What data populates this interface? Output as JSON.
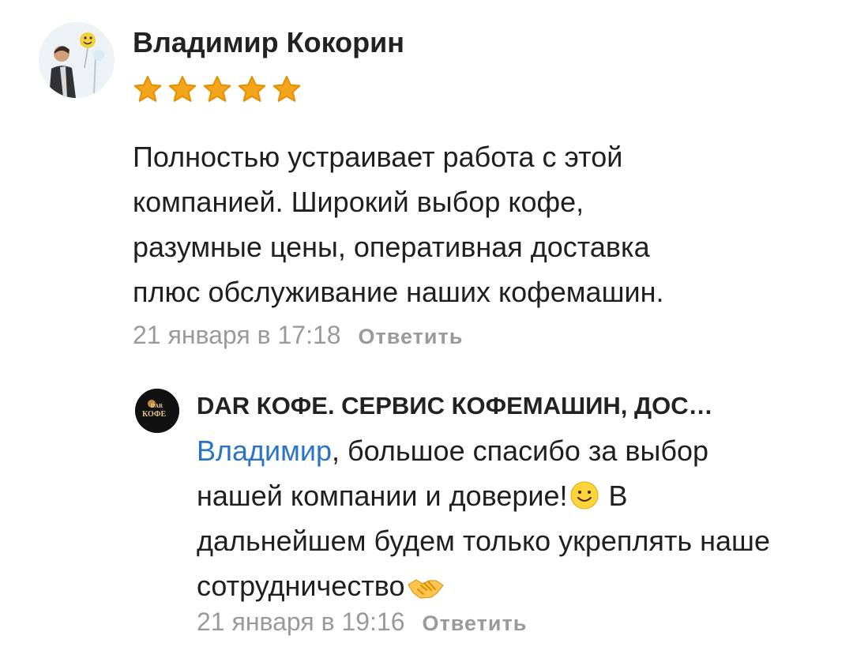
{
  "review": {
    "author": "Владимир Кокорин",
    "rating": 5,
    "text": "Полностью устраивает работа с этой\nкомпанией. Широкий выбор кофе,\nразумные цены, оперативная доставка\nплюс обслуживание наших кофемашин.",
    "date": "21 января в 17:18",
    "reply_label": "Ответить"
  },
  "answer": {
    "company_name": "DAR КОФЕ. СЕРВИС КОФЕМАШИН, ДОС…",
    "mention": "Владимир",
    "text_part1": ", большое спасибо за выбор нашей компании и доверие!",
    "text_part2": " В дальнейшем будем только укреплять наше сотрудничество",
    "date": "21 января в 19:16",
    "reply_label": "Ответить"
  },
  "icons": {
    "author_avatar": "user-photo-avatar",
    "company_avatar": "dar-coffee-logo",
    "smile": "slightly-smiling-face-emoji",
    "handshake": "handshake-emoji",
    "star": "star-icon"
  },
  "colors": {
    "star": "#f2a51a",
    "link": "#2a73c7",
    "muted": "#9a9a9a",
    "text": "#1f1f1f"
  }
}
